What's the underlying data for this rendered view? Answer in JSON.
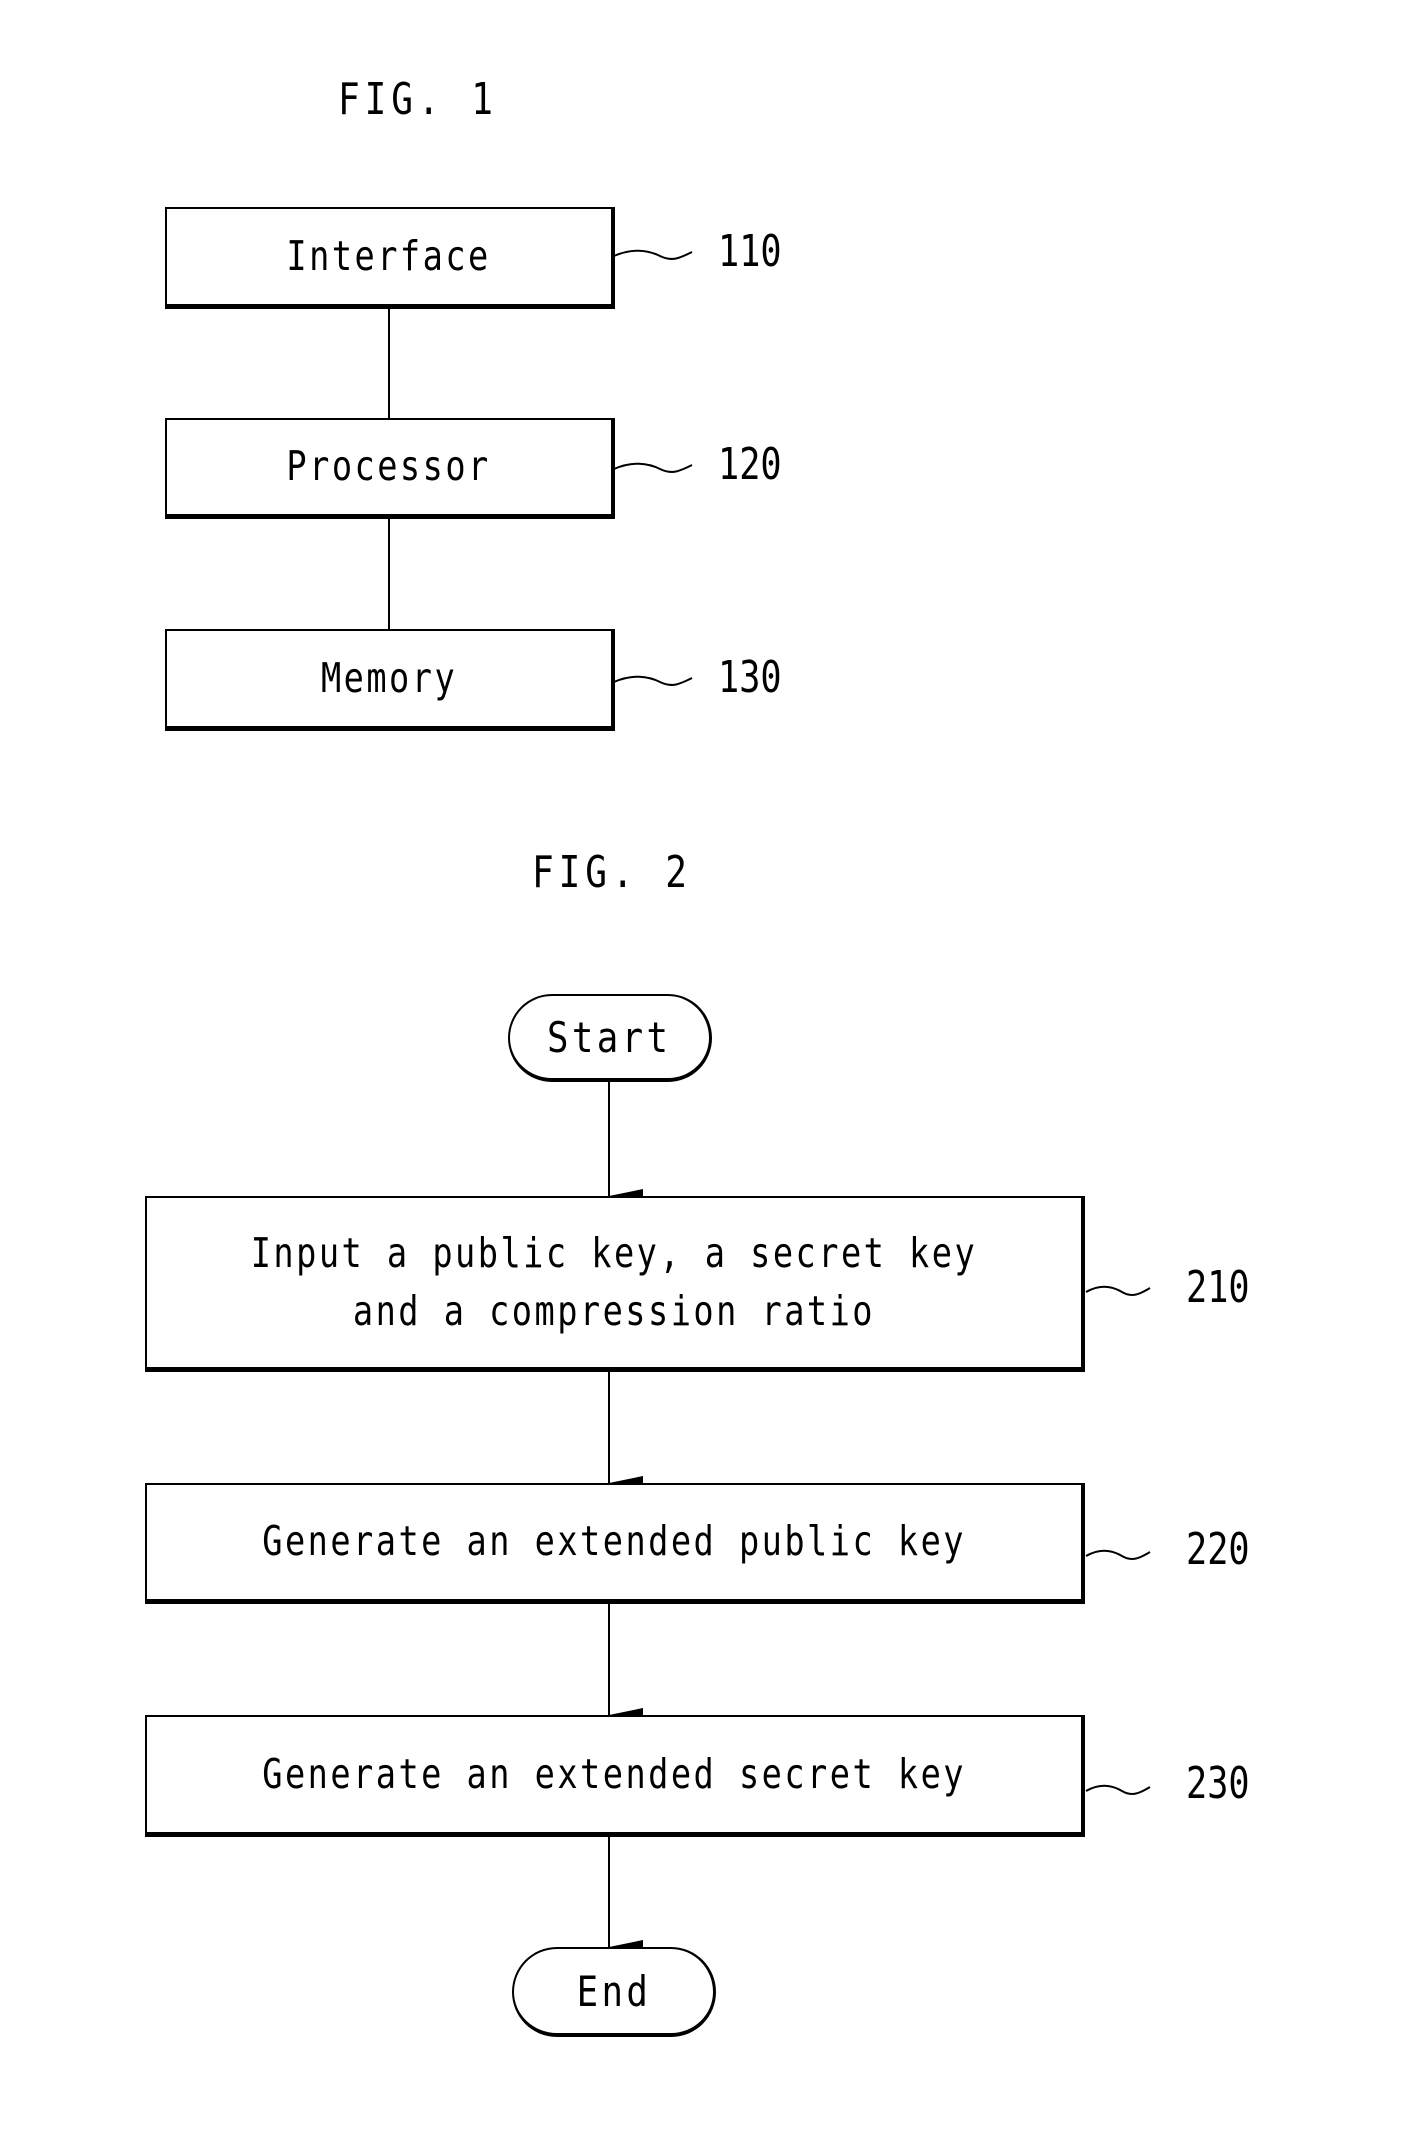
{
  "fig1": {
    "title": "FIG. 1",
    "blocks": [
      {
        "label": "Interface",
        "ref": "110"
      },
      {
        "label": "Processor",
        "ref": "120"
      },
      {
        "label": "Memory",
        "ref": "130"
      }
    ]
  },
  "fig2": {
    "title": "FIG. 2",
    "start": "Start",
    "steps": [
      {
        "label": "Input a public key, a secret key\nand a compression ratio",
        "ref": "210"
      },
      {
        "label": "Generate an extended public key",
        "ref": "220"
      },
      {
        "label": "Generate an extended secret key",
        "ref": "230"
      }
    ],
    "end": "End"
  }
}
